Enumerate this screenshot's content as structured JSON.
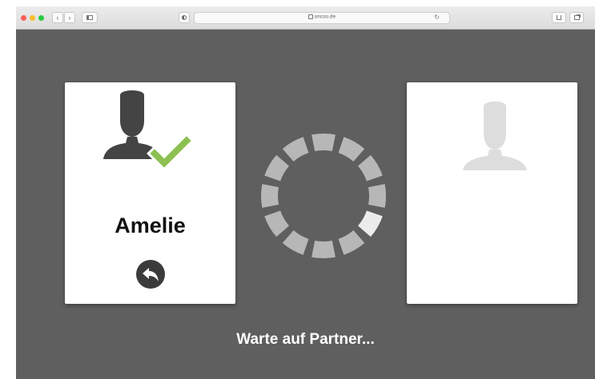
{
  "browser": {
    "url": "oncoo.de",
    "reload_glyph": "↻",
    "icons": [
      "back-chevron-icon",
      "forward-chevron-icon",
      "sidebar-icon",
      "shield-icon",
      "lock-icon",
      "reload-icon",
      "share-icon",
      "tabs-icon"
    ],
    "traffic_lights": [
      "#ff5f57",
      "#ffbd2e",
      "#28c940"
    ]
  },
  "left_card": {
    "avatar_icon": "person-icon",
    "check_icon": "checkmark-icon",
    "name": "Amelie",
    "back_icon": "undo-arrow-icon"
  },
  "right_card": {
    "avatar_icon": "person-placeholder-icon"
  },
  "spinner": {
    "segments": 12,
    "highlighted_segment": 4,
    "icon": "loading-spinner-icon"
  },
  "status_text": "Warte auf Partner...",
  "colors": {
    "background": "#5f5f5f",
    "card": "#ffffff",
    "check": "#8cc152",
    "avatar_dark": "#444444",
    "avatar_light": "#dddddd",
    "spinner_segment": "#b7b7b7",
    "spinner_highlight": "#ececec"
  }
}
